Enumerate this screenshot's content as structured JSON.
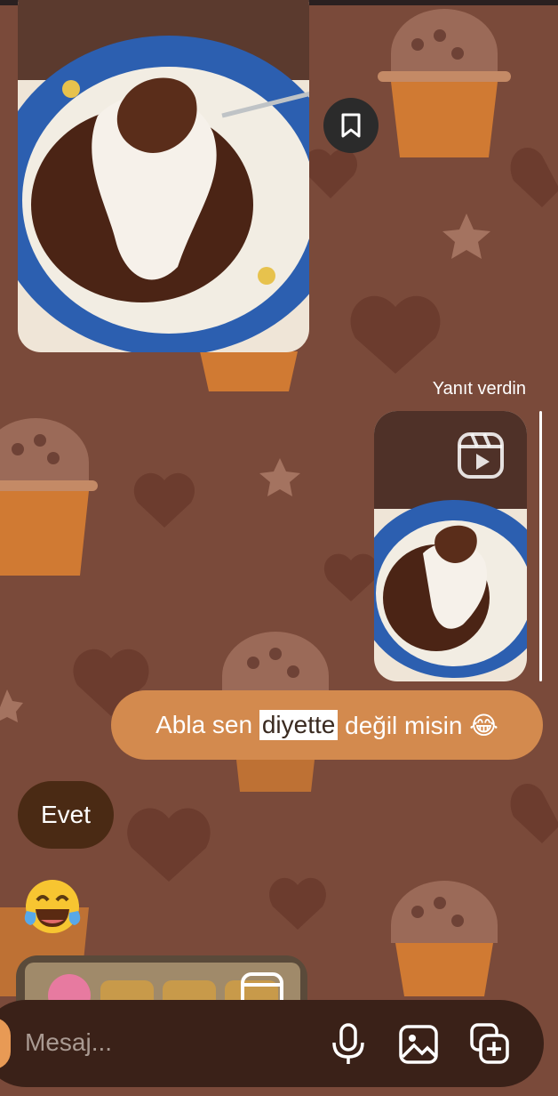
{
  "reply_label": "Yanıt verdin",
  "messages": {
    "outgoing_text_before": "Abla sen ",
    "outgoing_text_highlight": "diyette",
    "outgoing_text_after": " değil misin 😂",
    "incoming_text": "Evet",
    "emoji_message": "😂"
  },
  "composer": {
    "placeholder": "Mesaj..."
  },
  "icons": {
    "save": "bookmark-icon",
    "reel": "reel-icon",
    "mic": "microphone-icon",
    "gallery": "image-icon",
    "sticker": "sticker-add-icon"
  },
  "colors": {
    "background": "#7a4a3a",
    "outgoing_bubble": "#d38a4e",
    "incoming_bubble": "#4a2a14",
    "composer": "#3a2118"
  }
}
